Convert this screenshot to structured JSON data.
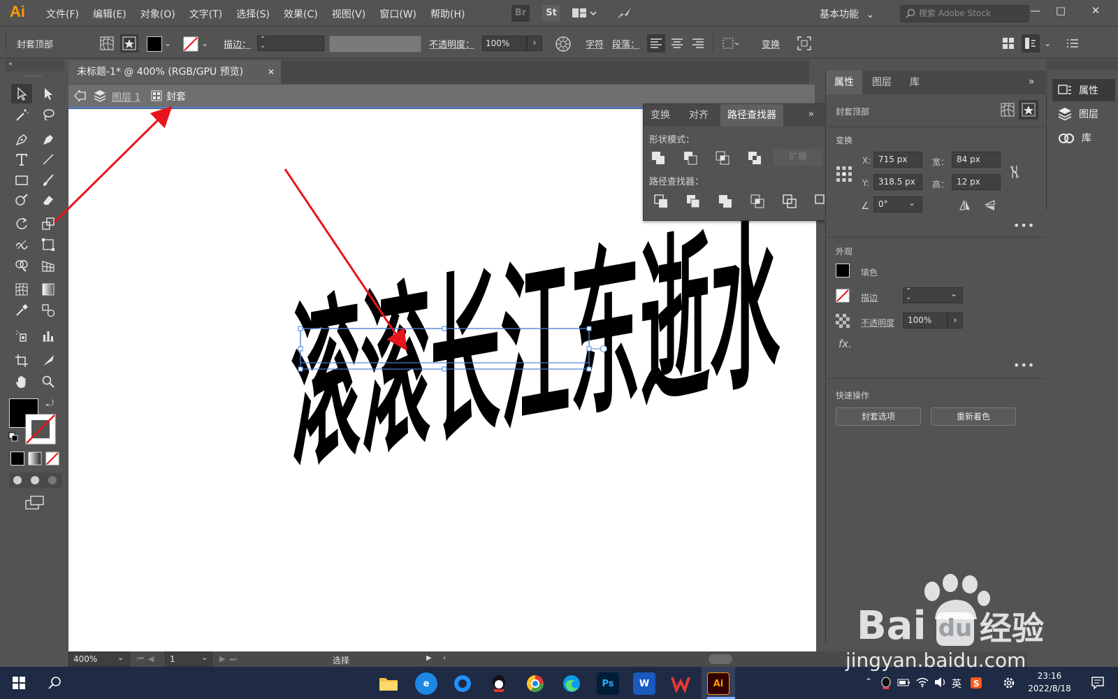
{
  "app": {
    "logo": "Ai",
    "menus": [
      "文件(F)",
      "编辑(E)",
      "对象(O)",
      "文字(T)",
      "选择(S)",
      "效果(C)",
      "视图(V)",
      "窗口(W)",
      "帮助(H)"
    ],
    "bridge_label": "Br",
    "stock_label": "St",
    "workspace": "基本功能",
    "search_placeholder": "搜索 Adobe Stock",
    "win_minimize": "—",
    "win_restore": "□",
    "win_close": "✕"
  },
  "control_bar": {
    "selection_label": "封套顶部",
    "stroke_label": "描边：",
    "opacity_label": "不透明度：",
    "opacity_value": "100%",
    "char_label": "字符",
    "para_label": "段落：",
    "transform_label": "变换"
  },
  "document": {
    "tab_title": "未标题-1* @ 400% (RGB/GPU 预览)",
    "tab_close": "✕",
    "breadcrumb_layer": "图层 1",
    "breadcrumb_envelope": "封套"
  },
  "canvas": {
    "artwork_text": "滚滚长江东逝水"
  },
  "status_bar": {
    "zoom": "400%",
    "page": "1",
    "mode": "选择"
  },
  "pathfinder_panel": {
    "tabs": [
      "变换",
      "对齐",
      "路径查找器"
    ],
    "active_tab": "路径查找器",
    "shape_modes_label": "形状模式：",
    "expand_label": "扩展",
    "pathfinders_label": "路径查找器："
  },
  "properties_panel": {
    "tabs": [
      "属性",
      "图层",
      "库"
    ],
    "active_tab": "属性",
    "selection_type": "封套顶部",
    "transform_title": "变换",
    "x_label": "X:",
    "x_value": "715 px",
    "y_label": "Y:",
    "y_value": "318.5 px",
    "w_label": "宽：",
    "w_value": "84 px",
    "h_label": "高：",
    "h_value": "12 px",
    "angle_value": "0°",
    "appearance_title": "外观",
    "fill_label": "填色",
    "stroke_label": "描边",
    "opacity_label": "不透明度",
    "opacity_value": "100%",
    "fx_label": "fx.",
    "quick_actions_title": "快速操作",
    "envelope_options_button": "封套选项",
    "recolor_button": "重新着色"
  },
  "dock": {
    "items": [
      "属性",
      "图层",
      "库"
    ]
  },
  "taskbar": {
    "ps_label": "Ps",
    "word_label": "W",
    "ai_label": "Ai",
    "ime_label": "英",
    "time": "23:16",
    "date": "2022/8/18"
  },
  "watermark": {
    "brand": "Bai",
    "brand_du": "du",
    "brand_cn": "经验",
    "url": "jingyan.baidu.com"
  },
  "colors": {
    "accent_orange": "#ff9a00",
    "selection_blue": "#4d7fd8",
    "arrow_red": "#e8141c"
  }
}
